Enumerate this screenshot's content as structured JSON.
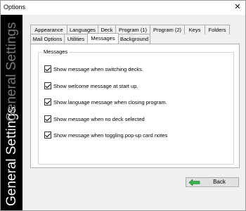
{
  "window": {
    "title": "Options",
    "close": "✕"
  },
  "sidebar": {
    "text": "General Settings"
  },
  "tabs_row1": [
    "Appearance",
    "Languages",
    "Deck",
    "Program (1)",
    "Program (2)",
    "Keys",
    "Folders"
  ],
  "tabs_row2": [
    "Mail Options",
    "Utilities",
    "Messages",
    "Background"
  ],
  "active_tab": "Messages",
  "group": {
    "label": "Messages",
    "options": [
      {
        "label": "Show message when switching decks.",
        "checked": true
      },
      {
        "label": "Show welcome message at start up.",
        "checked": true
      },
      {
        "label": "Show language message when closing program.",
        "checked": true
      },
      {
        "label": "Show message when no deck selected",
        "checked": true
      },
      {
        "label": "Show message when toggling pop-up card notes",
        "checked": true
      }
    ]
  },
  "footer": {
    "back_label": "Back"
  },
  "colors": {
    "sidebar_bg": "#000000",
    "sidebar_text": "#ffffff",
    "sidebar_text_dim": "#7a7a7a",
    "back_arrow": "#3cb04a"
  },
  "icons": {
    "close": "close-icon",
    "back": "arrow-left-icon",
    "check": "checkmark-icon"
  }
}
